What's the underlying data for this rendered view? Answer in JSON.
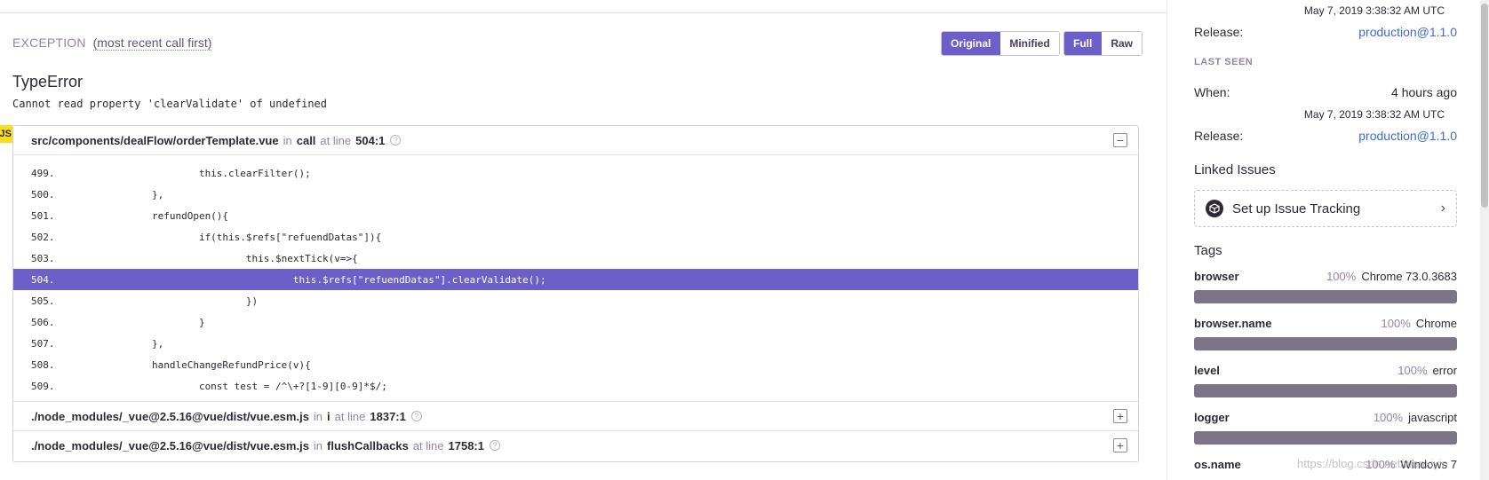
{
  "exception": {
    "title": "EXCEPTION",
    "subtitle": "(most recent call first)",
    "format_buttons": [
      "Original",
      "Minified"
    ],
    "view_buttons": [
      "Full",
      "Raw"
    ],
    "error_type": "TypeError",
    "error_message": "Cannot read property 'clearValidate' of undefined"
  },
  "platform_badge": "JS",
  "frames": [
    {
      "file": "src/components/dealFlow/orderTemplate.vue",
      "in_label": "in",
      "function": "call",
      "at_line_label": "at line",
      "line": "504:1",
      "expanded": true,
      "toggle": "−",
      "context": [
        {
          "num": "499.",
          "code": "                        this.clearFilter();"
        },
        {
          "num": "500.",
          "code": "                },"
        },
        {
          "num": "501.",
          "code": "                refundOpen(){"
        },
        {
          "num": "502.",
          "code": "                        if(this.$refs[\"refuendDatas\"]){"
        },
        {
          "num": "503.",
          "code": "                                this.$nextTick(v=>{"
        },
        {
          "num": "504.",
          "code": "                                        this.$refs[\"refuendDatas\"].clearValidate();",
          "active": true
        },
        {
          "num": "505.",
          "code": "                                })"
        },
        {
          "num": "506.",
          "code": "                        }"
        },
        {
          "num": "507.",
          "code": "                },"
        },
        {
          "num": "508.",
          "code": "                handleChangeRefundPrice(v){"
        },
        {
          "num": "509.",
          "code": "                        const test = /^\\+?[1-9][0-9]*$/;"
        }
      ]
    },
    {
      "file": "./node_modules/_vue@2.5.16@vue/dist/vue.esm.js",
      "in_label": "in",
      "function": "i",
      "at_line_label": "at line",
      "line": "1837:1",
      "toggle": "+"
    },
    {
      "file": "./node_modules/_vue@2.5.16@vue/dist/vue.esm.js",
      "in_label": "in",
      "function": "flushCallbacks",
      "at_line_label": "at line",
      "line": "1758:1",
      "toggle": "+"
    }
  ],
  "sidebar": {
    "first_seen": {
      "timestamp": "May 7, 2019 3:38:32 AM UTC",
      "release_label": "Release:",
      "release_value": "production@1.1.0"
    },
    "last_seen": {
      "label": "LAST SEEN",
      "when_label": "When:",
      "when_value": "4 hours ago",
      "timestamp": "May 7, 2019 3:38:32 AM UTC",
      "release_label": "Release:",
      "release_value": "production@1.1.0"
    },
    "linked_issues": {
      "title": "Linked Issues",
      "setup_label": "Set up Issue Tracking",
      "chevron": "›"
    },
    "tags": {
      "title": "Tags",
      "items": [
        {
          "key": "browser",
          "pct": "100%",
          "value": "Chrome 73.0.3683",
          "fraction": 1.0
        },
        {
          "key": "browser.name",
          "pct": "100%",
          "value": "Chrome",
          "fraction": 1.0
        },
        {
          "key": "level",
          "pct": "100%",
          "value": "error",
          "fraction": 1.0
        },
        {
          "key": "logger",
          "pct": "100%",
          "value": "javascript",
          "fraction": 1.0
        },
        {
          "key": "os.name",
          "pct": "100%",
          "value": "Windows 7",
          "fraction": 1.0
        }
      ]
    }
  },
  "watermark": "https://blog.csdn.net/wenxiyin"
}
